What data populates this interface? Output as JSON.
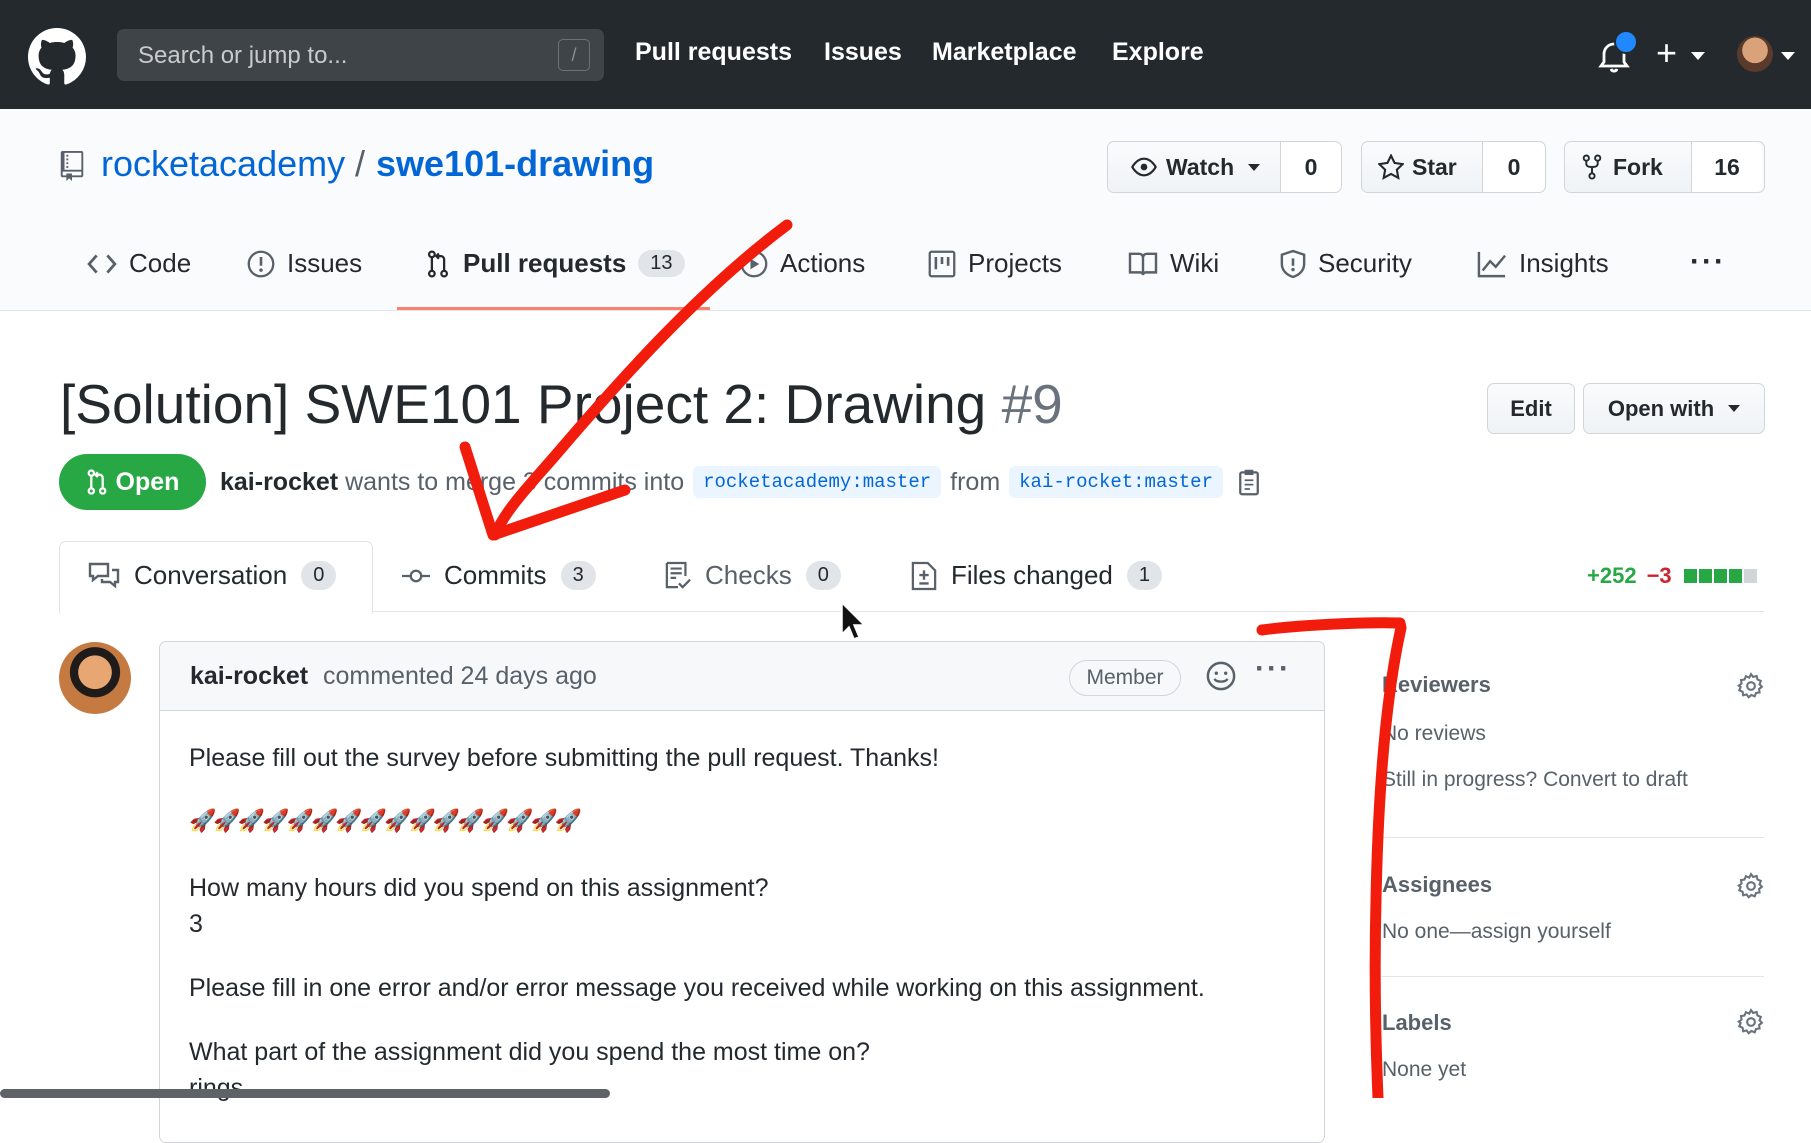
{
  "topnav": {
    "search_placeholder": "Search or jump to...",
    "search_shortcut": "/",
    "links": [
      "Pull requests",
      "Issues",
      "Marketplace",
      "Explore"
    ],
    "plus_label": "+"
  },
  "repo": {
    "owner": "rocketacademy",
    "separator": "/",
    "name": "swe101-drawing",
    "watch_label": "Watch",
    "watch_count": "0",
    "star_label": "Star",
    "star_count": "0",
    "fork_label": "Fork",
    "fork_count": "16"
  },
  "repo_tabs": [
    {
      "label": "Code"
    },
    {
      "label": "Issues"
    },
    {
      "label": "Pull requests",
      "count": "13"
    },
    {
      "label": "Actions"
    },
    {
      "label": "Projects"
    },
    {
      "label": "Wiki"
    },
    {
      "label": "Security"
    },
    {
      "label": "Insights"
    }
  ],
  "repo_tabs_more": "···",
  "pr": {
    "title": "[Solution] SWE101 Project 2: Drawing",
    "number": "#9",
    "edit_label": "Edit",
    "open_with_label": "Open with",
    "state": "Open",
    "author": "kai-rocket",
    "meta_text": "wants to merge 3 commits into",
    "base_branch": "rocketacademy:master",
    "from_text": "from",
    "head_branch": "kai-rocket:master"
  },
  "pr_tabs": [
    {
      "label": "Conversation",
      "count": "0"
    },
    {
      "label": "Commits",
      "count": "3"
    },
    {
      "label": "Checks",
      "count": "0"
    },
    {
      "label": "Files changed",
      "count": "1"
    }
  ],
  "diffstat": {
    "additions": "+252",
    "deletions": "−3",
    "colors": [
      "#28a745",
      "#28a745",
      "#28a745",
      "#28a745",
      "#d1d5da"
    ]
  },
  "comment": {
    "author": "kai-rocket",
    "meta": "commented 24 days ago",
    "badge": "Member",
    "more": "···",
    "lines": [
      "Please fill out the survey before submitting the pull request. Thanks!",
      "🚀🚀🚀🚀🚀🚀🚀🚀🚀🚀🚀🚀🚀🚀🚀🚀",
      "How many hours did you spend on this assignment?",
      "3",
      "Please fill in one error and/or error message you received while working on this assignment.",
      "What part of the assignment did you spend the most time on?",
      "rings"
    ]
  },
  "sidebar": {
    "reviewers_title": "Reviewers",
    "reviewers_value": "No reviews",
    "reviewers_hint": "Still in progress? Convert to draft",
    "assignees_title": "Assignees",
    "assignees_value": "No one—assign yourself",
    "labels_title": "Labels",
    "labels_value": "None yet"
  },
  "colors": {
    "header_bg": "#24292e",
    "link_blue": "#0366d6",
    "open_green": "#28a745",
    "annotation_red": "#f21c0d"
  }
}
